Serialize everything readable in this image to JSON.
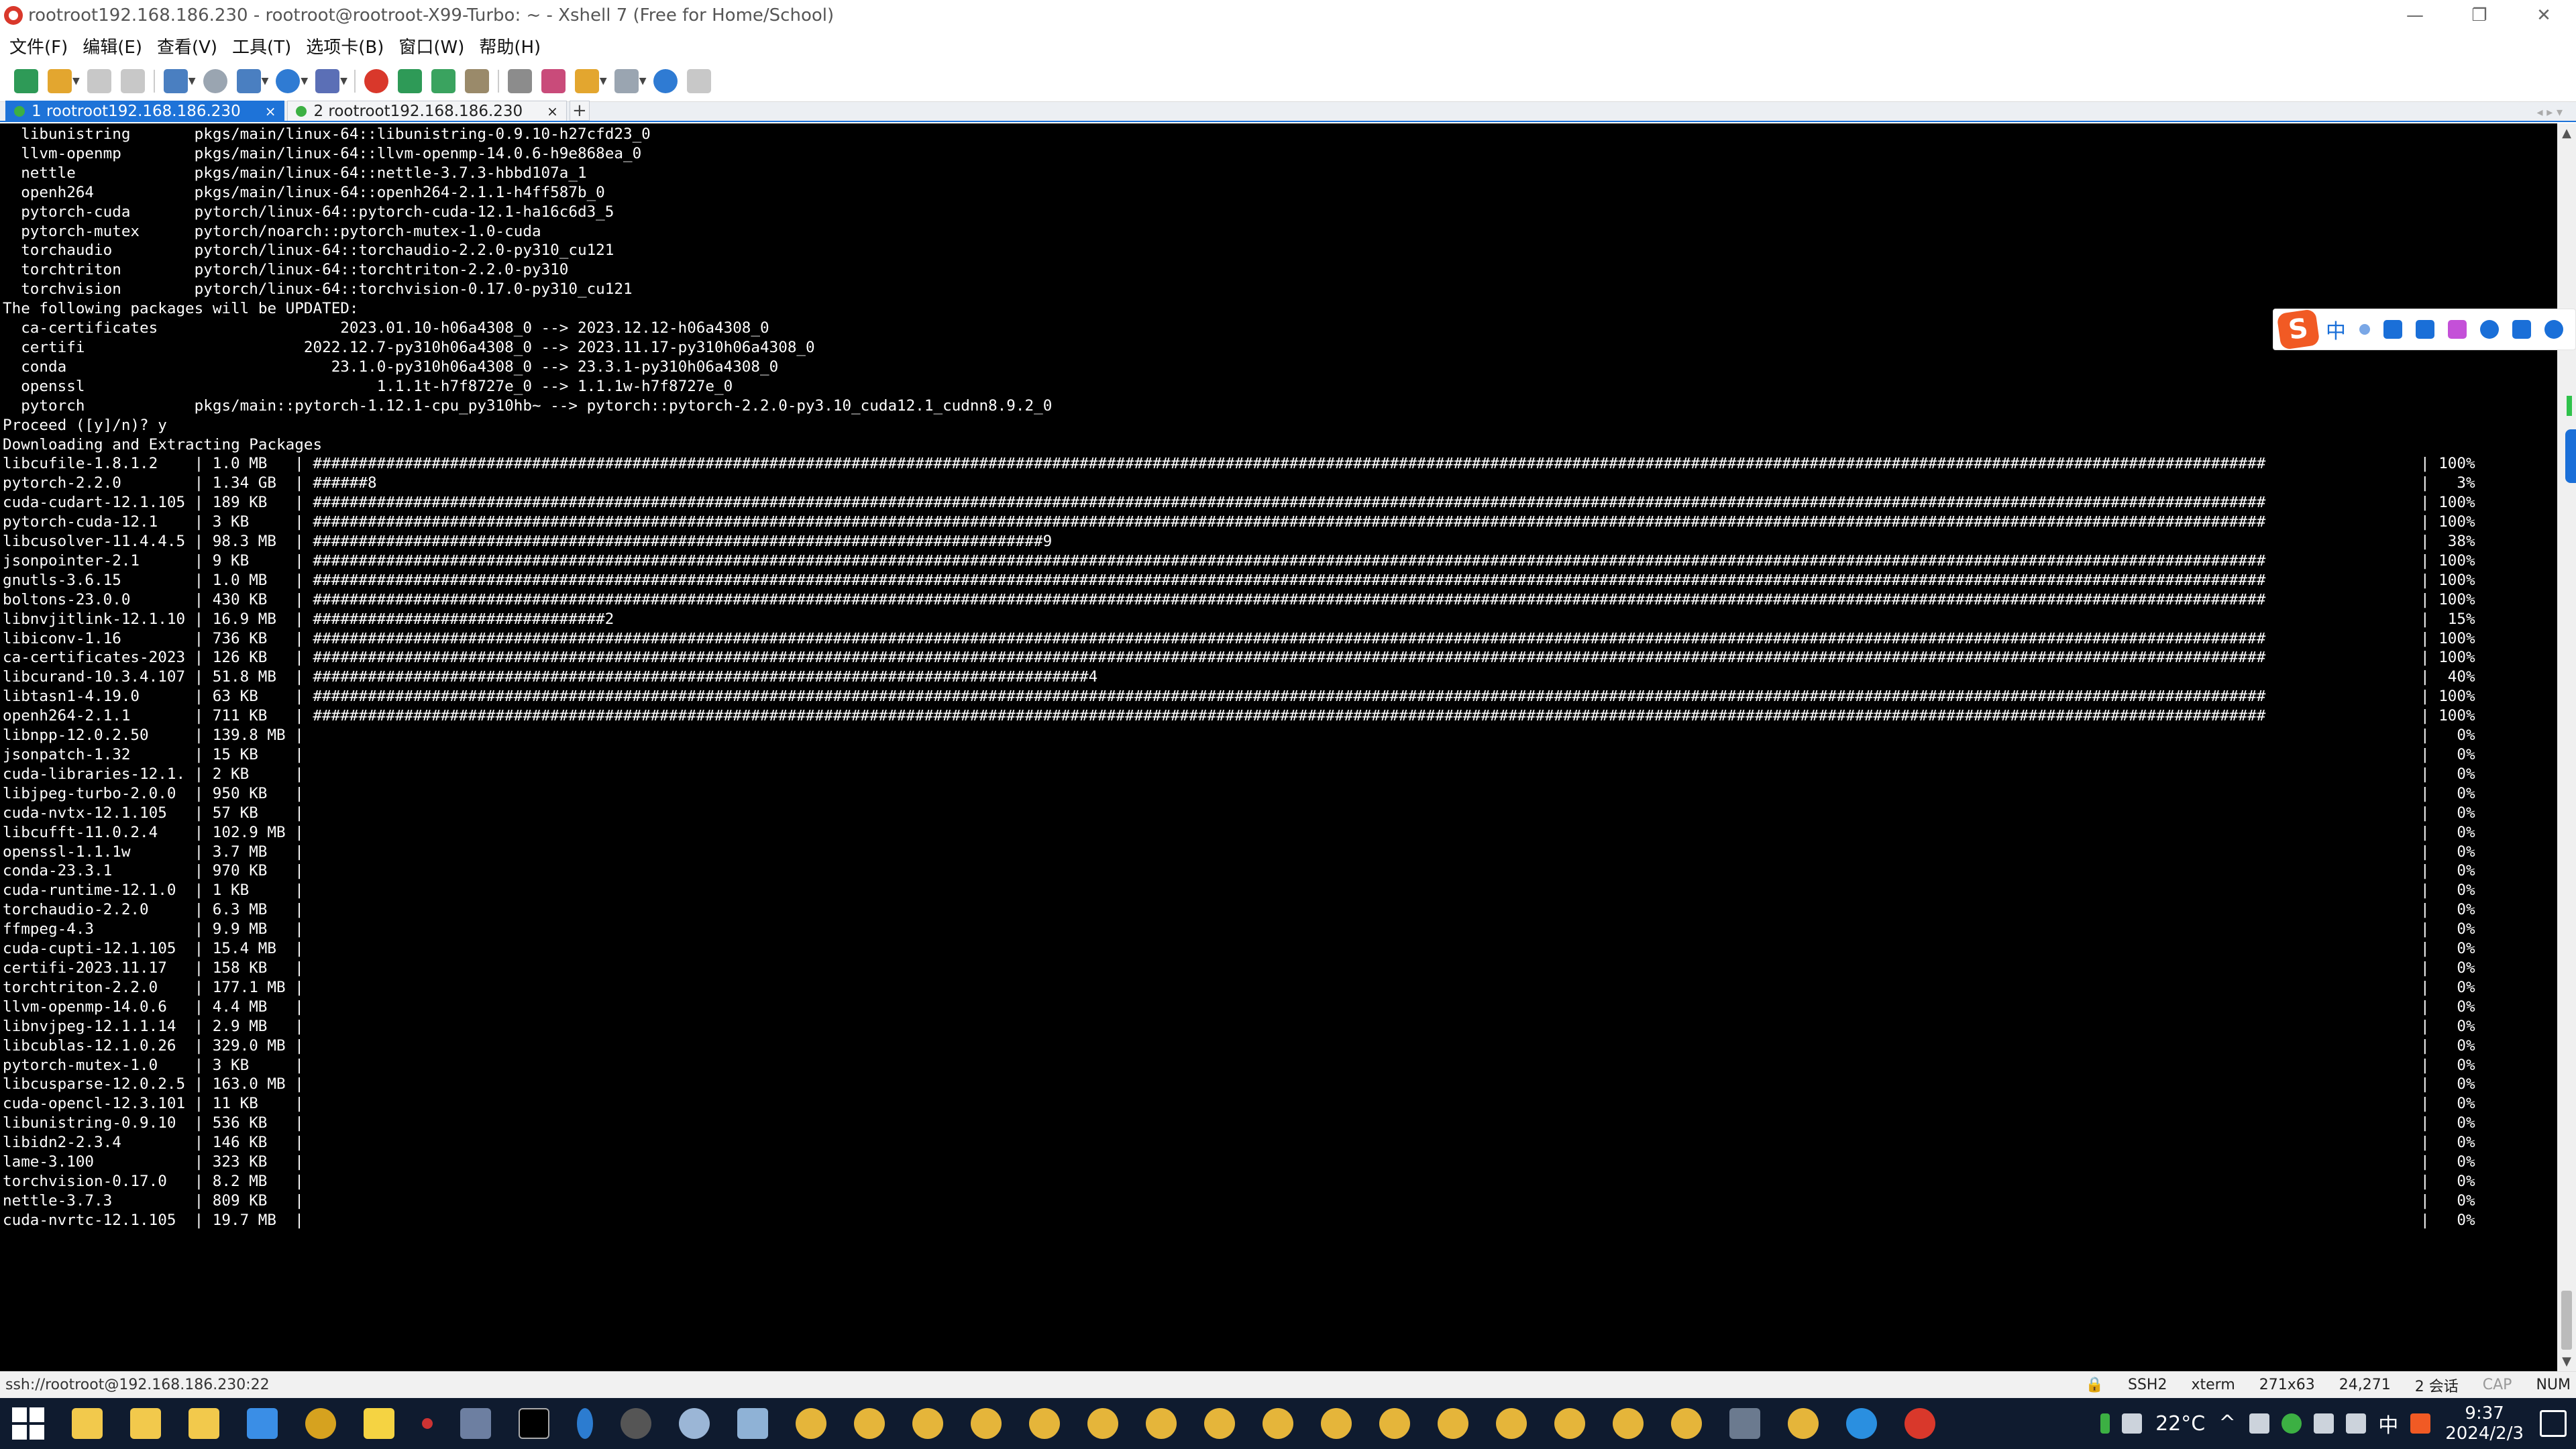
{
  "window": {
    "title": "rootroot192.168.186.230 - rootroot@rootroot-X99-Turbo: ~ - Xshell 7 (Free for Home/School)",
    "min_glyph": "—",
    "max_glyph": "❐",
    "close_glyph": "✕"
  },
  "menu": [
    "文件(F)",
    "编辑(E)",
    "查看(V)",
    "工具(T)",
    "选项卡(B)",
    "窗口(W)",
    "帮助(H)"
  ],
  "tabs": [
    {
      "label": "1 rootroot192.168.186.230",
      "active": true,
      "close": "×"
    },
    {
      "label": "2 rootroot192.168.186.230",
      "active": false,
      "close": "×"
    }
  ],
  "tab_add": "+",
  "tab_nav": "◂ ▸ ▾",
  "terminal": {
    "lines": [
      "  libunistring       pkgs/main/linux-64::libunistring-0.9.10-h27cfd23_0",
      "  llvm-openmp        pkgs/main/linux-64::llvm-openmp-14.0.6-h9e868ea_0",
      "  nettle             pkgs/main/linux-64::nettle-3.7.3-hbbd107a_1",
      "  openh264           pkgs/main/linux-64::openh264-2.1.1-h4ff587b_0",
      "  pytorch-cuda       pytorch/linux-64::pytorch-cuda-12.1-ha16c6d3_5",
      "  pytorch-mutex      pytorch/noarch::pytorch-mutex-1.0-cuda",
      "  torchaudio         pytorch/linux-64::torchaudio-2.2.0-py310_cu121",
      "  torchtriton        pytorch/linux-64::torchtriton-2.2.0-py310",
      "  torchvision        pytorch/linux-64::torchvision-0.17.0-py310_cu121",
      "",
      "The following packages will be UPDATED:",
      "",
      "  ca-certificates                    2023.01.10-h06a4308_0 --> 2023.12.12-h06a4308_0",
      "  certifi                        2022.12.7-py310h06a4308_0 --> 2023.11.17-py310h06a4308_0",
      "  conda                             23.1.0-py310h06a4308_0 --> 23.3.1-py310h06a4308_0",
      "  openssl                                1.1.1t-h7f8727e_0 --> 1.1.1w-h7f8727e_0",
      "  pytorch            pkgs/main::pytorch-1.12.1-cpu_py310hb~ --> pytorch::pytorch-2.2.0-py3.10_cuda12.1_cudnn8.9.2_0",
      "",
      "",
      "Proceed ([y]/n)? y",
      "",
      "",
      "Downloading and Extracting Packages"
    ],
    "downloads": [
      {
        "name": "libcufile-1.8.1.2",
        "size": "1.0 MB",
        "bar": "######################################################################################################################################################################################################################",
        "pct": "100%"
      },
      {
        "name": "pytorch-2.2.0",
        "size": "1.34 GB",
        "bar": "######8",
        "pct": "3%"
      },
      {
        "name": "cuda-cudart-12.1.105",
        "size": "189 KB",
        "bar": "######################################################################################################################################################################################################################",
        "pct": "100%"
      },
      {
        "name": "pytorch-cuda-12.1",
        "size": "3 KB",
        "bar": "######################################################################################################################################################################################################################",
        "pct": "100%"
      },
      {
        "name": "libcusolver-11.4.4.5",
        "size": "98.3 MB",
        "bar": "################################################################################9",
        "pct": "38%"
      },
      {
        "name": "jsonpointer-2.1",
        "size": "9 KB",
        "bar": "######################################################################################################################################################################################################################",
        "pct": "100%"
      },
      {
        "name": "gnutls-3.6.15",
        "size": "1.0 MB",
        "bar": "######################################################################################################################################################################################################################",
        "pct": "100%"
      },
      {
        "name": "boltons-23.0.0",
        "size": "430 KB",
        "bar": "######################################################################################################################################################################################################################",
        "pct": "100%"
      },
      {
        "name": "libnvjitlink-12.1.10",
        "size": "16.9 MB",
        "bar": "################################2",
        "pct": "15%"
      },
      {
        "name": "libiconv-1.16",
        "size": "736 KB",
        "bar": "######################################################################################################################################################################################################################",
        "pct": "100%"
      },
      {
        "name": "ca-certificates-2023",
        "size": "126 KB",
        "bar": "######################################################################################################################################################################################################################",
        "pct": "100%"
      },
      {
        "name": "libcurand-10.3.4.107",
        "size": "51.8 MB",
        "bar": "#####################################################################################4",
        "pct": "40%"
      },
      {
        "name": "libtasn1-4.19.0",
        "size": "63 KB",
        "bar": "######################################################################################################################################################################################################################",
        "pct": "100%"
      },
      {
        "name": "openh264-2.1.1",
        "size": "711 KB",
        "bar": "######################################################################################################################################################################################################################",
        "pct": "100%"
      },
      {
        "name": "libnpp-12.0.2.50",
        "size": "139.8 MB",
        "bar": "",
        "pct": "0%"
      },
      {
        "name": "jsonpatch-1.32",
        "size": "15 KB",
        "bar": "",
        "pct": "0%"
      },
      {
        "name": "cuda-libraries-12.1.",
        "size": "2 KB",
        "bar": "",
        "pct": "0%"
      },
      {
        "name": "libjpeg-turbo-2.0.0",
        "size": "950 KB",
        "bar": "",
        "pct": "0%"
      },
      {
        "name": "cuda-nvtx-12.1.105",
        "size": "57 KB",
        "bar": "",
        "pct": "0%"
      },
      {
        "name": "libcufft-11.0.2.4",
        "size": "102.9 MB",
        "bar": "",
        "pct": "0%"
      },
      {
        "name": "openssl-1.1.1w",
        "size": "3.7 MB",
        "bar": "",
        "pct": "0%"
      },
      {
        "name": "conda-23.3.1",
        "size": "970 KB",
        "bar": "",
        "pct": "0%"
      },
      {
        "name": "cuda-runtime-12.1.0",
        "size": "1 KB",
        "bar": "",
        "pct": "0%"
      },
      {
        "name": "torchaudio-2.2.0",
        "size": "6.3 MB",
        "bar": "",
        "pct": "0%"
      },
      {
        "name": "ffmpeg-4.3",
        "size": "9.9 MB",
        "bar": "",
        "pct": "0%"
      },
      {
        "name": "cuda-cupti-12.1.105",
        "size": "15.4 MB",
        "bar": "",
        "pct": "0%"
      },
      {
        "name": "certifi-2023.11.17",
        "size": "158 KB",
        "bar": "",
        "pct": "0%"
      },
      {
        "name": "torchtriton-2.2.0",
        "size": "177.1 MB",
        "bar": "",
        "pct": "0%"
      },
      {
        "name": "llvm-openmp-14.0.6",
        "size": "4.4 MB",
        "bar": "",
        "pct": "0%"
      },
      {
        "name": "libnvjpeg-12.1.1.14",
        "size": "2.9 MB",
        "bar": "",
        "pct": "0%"
      },
      {
        "name": "libcublas-12.1.0.26",
        "size": "329.0 MB",
        "bar": "",
        "pct": "0%"
      },
      {
        "name": "pytorch-mutex-1.0",
        "size": "3 KB",
        "bar": "",
        "pct": "0%"
      },
      {
        "name": "libcusparse-12.0.2.5",
        "size": "163.0 MB",
        "bar": "",
        "pct": "0%"
      },
      {
        "name": "cuda-opencl-12.3.101",
        "size": "11 KB",
        "bar": "",
        "pct": "0%"
      },
      {
        "name": "libunistring-0.9.10",
        "size": "536 KB",
        "bar": "",
        "pct": "0%"
      },
      {
        "name": "libidn2-2.3.4",
        "size": "146 KB",
        "bar": "",
        "pct": "0%"
      },
      {
        "name": "lame-3.100",
        "size": "323 KB",
        "bar": "",
        "pct": "0%"
      },
      {
        "name": "torchvision-0.17.0",
        "size": "8.2 MB",
        "bar": "",
        "pct": "0%"
      },
      {
        "name": "nettle-3.7.3",
        "size": "809 KB",
        "bar": "",
        "pct": "0%"
      },
      {
        "name": "cuda-nvrtc-12.1.105",
        "size": "19.7 MB",
        "bar": "",
        "pct": "0%"
      }
    ]
  },
  "ime": {
    "logo": "S",
    "mode": "中"
  },
  "statusbar": {
    "connection": "ssh://rootroot@192.168.186.230:22",
    "protocol": "SSH2",
    "term": "xterm",
    "size": "271x63",
    "cursor": "24,271",
    "sessions": "2 会话",
    "cap": "CAP",
    "num": "NUM"
  },
  "taskbar": {
    "weather": "22°C",
    "ime": "中",
    "time": "9:37",
    "date": "2024/2/3"
  },
  "colors": {
    "accent": "#1e73d8",
    "terminal_bg": "#000000",
    "taskbar_bg": "#0f1b2f"
  }
}
